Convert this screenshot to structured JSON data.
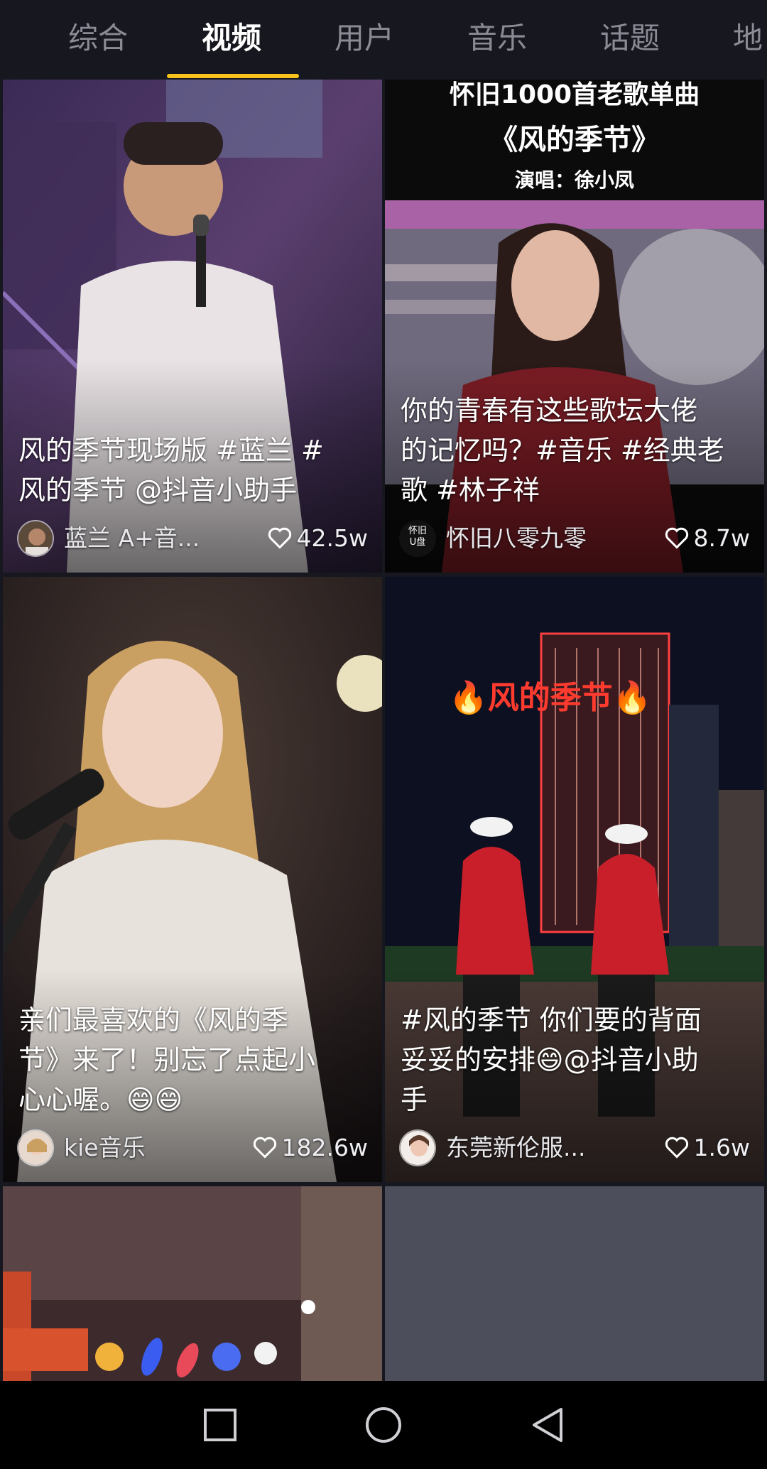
{
  "tabs": [
    {
      "label": "综合",
      "active": false
    },
    {
      "label": "视频",
      "active": true
    },
    {
      "label": "用户",
      "active": false
    },
    {
      "label": "音乐",
      "active": false
    },
    {
      "label": "话题",
      "active": false
    },
    {
      "label": "地",
      "active": false
    }
  ],
  "accent_color": "#f7c21c",
  "videos": [
    {
      "caption": "风的季节现场版 #蓝兰 #\n风的季节 @抖音小助手",
      "author": "蓝兰 A+音...",
      "likes": "42.5w"
    },
    {
      "overlay_title_1": "怀旧1000首老歌单曲",
      "overlay_title_2": "《风的季节》",
      "overlay_singer": "演唱：徐小凤",
      "caption": "你的青春有这些歌坛大佬\n的记忆吗？#音乐 #经典老\n歌 #林子祥",
      "author_logo": "怀旧\nU盘",
      "author": "怀旧八零九零",
      "likes": "8.7w"
    },
    {
      "caption": "亲们最喜欢的《风的季\n节》来了！别忘了点起小\n心心喔。😄😄",
      "author": "kie音乐",
      "likes": "182.6w"
    },
    {
      "overlay_tag": "🔥风的季节🔥",
      "caption": "#风的季节 你们要的背面\n妥妥的安排😄@抖音小助\n手",
      "author": "东莞新伦服...",
      "likes": "1.6w"
    }
  ],
  "icons": {
    "like": "heart-outline-icon",
    "nav_recent": "square-icon",
    "nav_home": "circle-icon",
    "nav_back": "triangle-back-icon"
  }
}
